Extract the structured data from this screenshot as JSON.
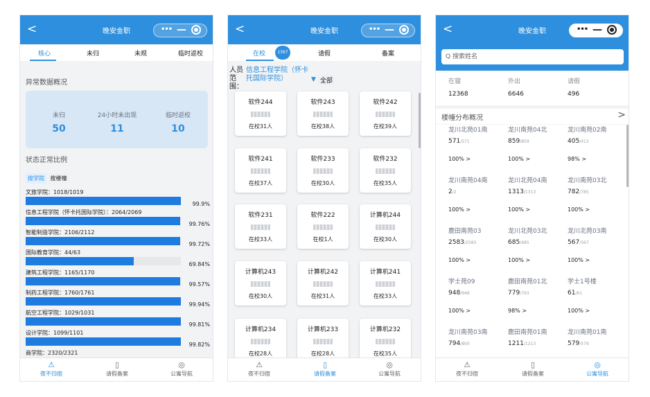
{
  "app": {
    "title": "晚安金职",
    "back": "<"
  },
  "capsule": {
    "dots": "•••",
    "minus": "—"
  },
  "panel1": {
    "tabs": [
      "核心",
      "未归",
      "未规",
      "临时返校"
    ],
    "section_abnormal": "异常数据概况",
    "summary": [
      {
        "label": "未归",
        "value": "50"
      },
      {
        "label": "24小时未出现",
        "value": "11"
      },
      {
        "label": "临时返校",
        "value": "10"
      }
    ],
    "section_ratio": "状态正常比例",
    "filters": [
      "按学院",
      "按楼幢"
    ],
    "bars": [
      {
        "label": "文旅学院：1018/1019",
        "pct": "99.9%",
        "ratio": 0.999
      },
      {
        "label": "信息工程学院（怀卡托国际学院）：2064/2069",
        "pct": "99.76%",
        "ratio": 0.9976
      },
      {
        "label": "智能制造学院：2106/2112",
        "pct": "99.72%",
        "ratio": 0.9972
      },
      {
        "label": "国际教育学院：44/63",
        "pct": "69.84%",
        "ratio": 0.6984
      },
      {
        "label": "建筑工程学院：1165/1170",
        "pct": "99.57%",
        "ratio": 0.9957
      },
      {
        "label": "制药工程学院：1760/1761",
        "pct": "99.94%",
        "ratio": 0.9994
      },
      {
        "label": "航空工程学院：1029/1031",
        "pct": "99.81%",
        "ratio": 0.9981
      },
      {
        "label": "设计学院：1099/1101",
        "pct": "99.82%",
        "ratio": 0.9982
      },
      {
        "label": "商学院：2320/2321",
        "pct": "",
        "ratio": 0.9996
      }
    ]
  },
  "panel2": {
    "tabs": [
      "在校",
      "请假",
      "备案"
    ],
    "badge": "1367",
    "scope_key": "人员范围：",
    "scope_value": "信息工程学院（怀卡托国际学院）",
    "dropdown_icon": "▼",
    "all_label": "全部",
    "cards": [
      {
        "name": "软件244",
        "count": "在校31人"
      },
      {
        "name": "软件243",
        "count": "在校38人"
      },
      {
        "name": "软件242",
        "count": "在校39人"
      },
      {
        "name": "软件241",
        "count": "在校37人"
      },
      {
        "name": "软件233",
        "count": "在校30人"
      },
      {
        "name": "软件232",
        "count": "在校35人"
      },
      {
        "name": "软件231",
        "count": "在校33人"
      },
      {
        "name": "软件222",
        "count": "在校1人"
      },
      {
        "name": "计算机244",
        "count": "在校30人"
      },
      {
        "name": "计算机243",
        "count": "在校30人"
      },
      {
        "name": "计算机242",
        "count": "在校31人"
      },
      {
        "name": "计算机241",
        "count": "在校33人"
      },
      {
        "name": "计算机234",
        "count": "在校28人"
      },
      {
        "name": "计算机233",
        "count": "在校28人"
      },
      {
        "name": "计算机232",
        "count": "在校35人"
      }
    ]
  },
  "panel3": {
    "search_placeholder": "Q 搜索姓名",
    "stats": [
      {
        "label": "在寝",
        "value": "12368"
      },
      {
        "label": "外出",
        "value": "6646"
      },
      {
        "label": "请假",
        "value": "496"
      }
    ],
    "dist_title": "楼幢分布概况",
    "dist_arrow": ">",
    "buildings": [
      {
        "name": "龙川北苑01南",
        "count": "571",
        "total": "/571",
        "rate": "100% >"
      },
      {
        "name": "龙川南苑04北",
        "count": "859",
        "total": "/859",
        "rate": "100% >"
      },
      {
        "name": "龙川南苑02南",
        "count": "405",
        "total": "/413",
        "rate": "98% >"
      },
      {
        "name": "龙川南苑04南",
        "count": "2",
        "total": "/2",
        "rate": "100% >"
      },
      {
        "name": "龙川北苑04南",
        "count": "1313",
        "total": "/1313",
        "rate": "100% >"
      },
      {
        "name": "龙川南苑03北",
        "count": "782",
        "total": "/785",
        "rate": "100% >"
      },
      {
        "name": "鹿田南苑03",
        "count": "2583",
        "total": "/2583",
        "rate": "100% >"
      },
      {
        "name": "龙川北苑03北",
        "count": "685",
        "total": "/685",
        "rate": "100% >"
      },
      {
        "name": "龙川北苑03南",
        "count": "567",
        "total": "/567",
        "rate": "100% >"
      },
      {
        "name": "学士苑09",
        "count": "948",
        "total": "/948",
        "rate": "100% >"
      },
      {
        "name": "鹿田南苑01北",
        "count": "779",
        "total": "/793",
        "rate": "98% >"
      },
      {
        "name": "学士1号楼",
        "count": "61",
        "total": "/61",
        "rate": "100% >"
      },
      {
        "name": "龙川南苑03南",
        "count": "794",
        "total": "/800",
        "rate": ""
      },
      {
        "name": "鹿田南苑01南",
        "count": "1211",
        "total": "/1213",
        "rate": ""
      },
      {
        "name": "龙川南苑01南",
        "count": "579",
        "total": "/579",
        "rate": ""
      }
    ]
  },
  "nav": [
    {
      "label": "夜不归宿",
      "icon": "warning-icon"
    },
    {
      "label": "请假备案",
      "icon": "bookmark-icon"
    },
    {
      "label": "公寓导航",
      "icon": "location-icon"
    }
  ],
  "colors": {
    "primary": "#2e8fde",
    "bar": "#1e7be0"
  }
}
